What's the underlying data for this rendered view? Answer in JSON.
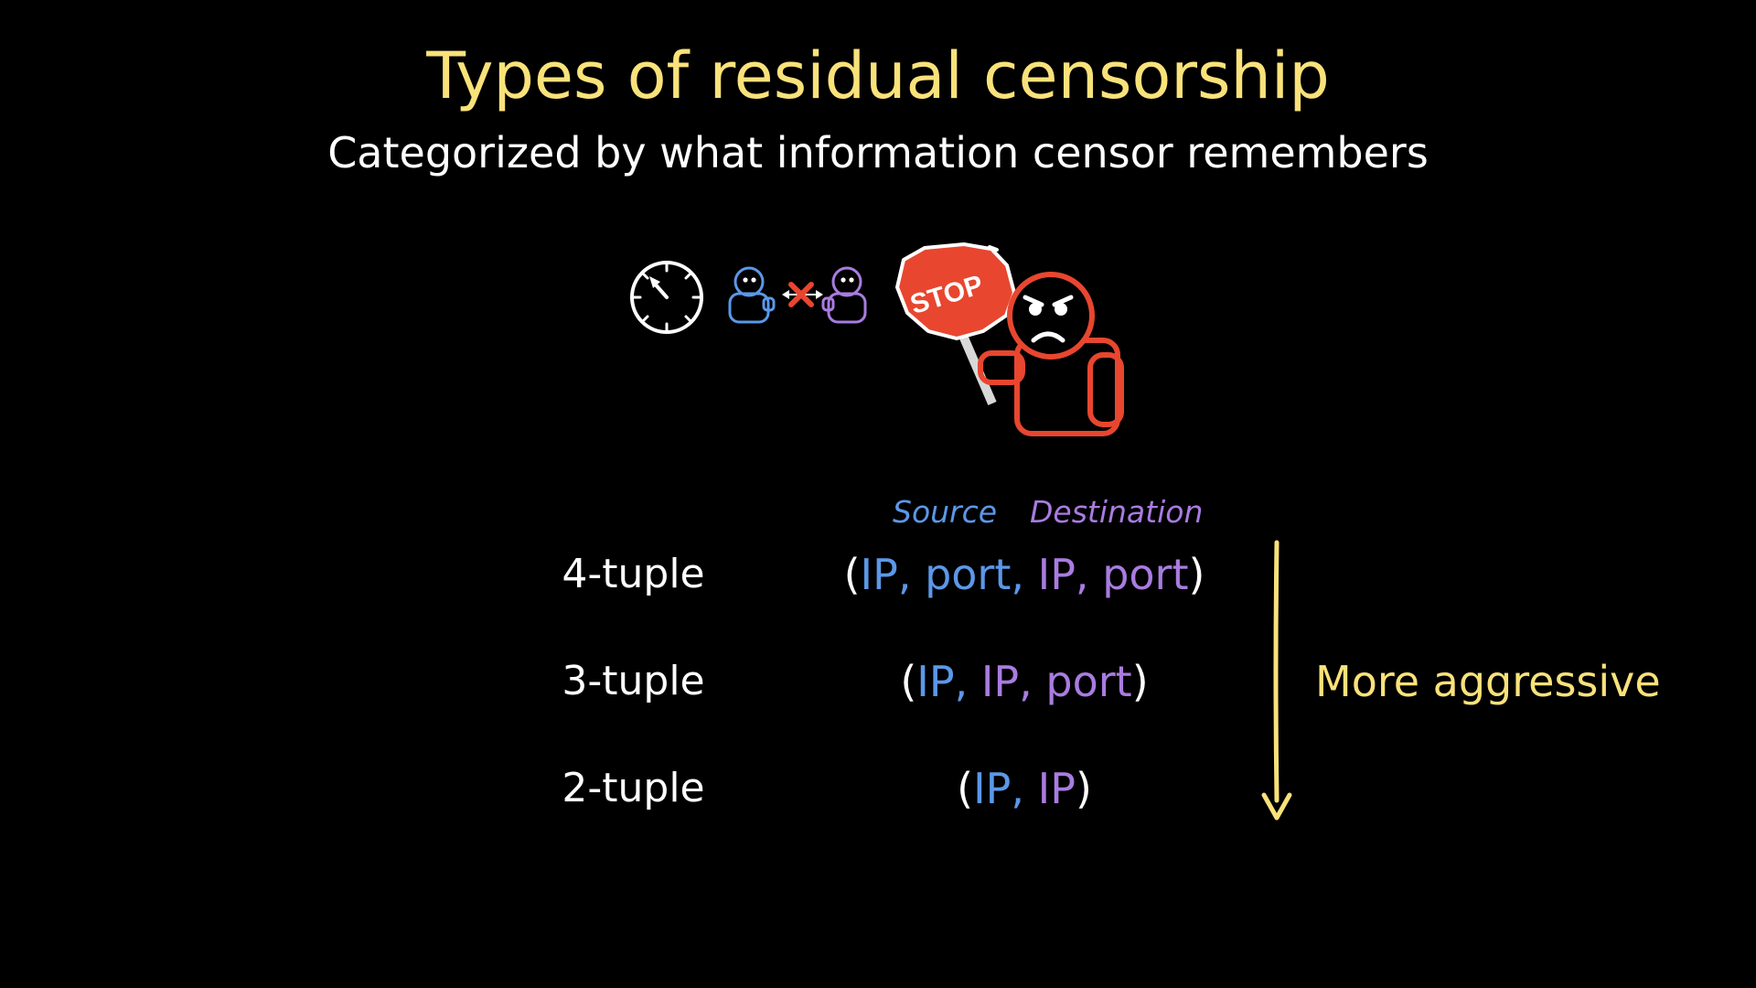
{
  "title": "Types of residual censorship",
  "subtitle": "Categorized by what information censor remembers",
  "illustration": {
    "stop_sign_text": "STOP",
    "colors": {
      "timer": "#ffffff",
      "client": "#5b98e8",
      "server": "#a97ce0",
      "block_mark": "#e8462f",
      "censor": "#e8462f",
      "sign_pole": "#d8d8d8"
    }
  },
  "columns": {
    "source": "Source",
    "destination": "Destination"
  },
  "rows": [
    {
      "label": "4-tuple",
      "open": "(",
      "parts": [
        {
          "text": "IP,",
          "role": "source"
        },
        {
          "text": "port,",
          "role": "source"
        },
        {
          "text": "IP,",
          "role": "destination"
        },
        {
          "text": "port",
          "role": "destination"
        }
      ],
      "close": ")"
    },
    {
      "label": "3-tuple",
      "open": "(",
      "parts": [
        {
          "text": "IP,",
          "role": "source"
        },
        {
          "text": "IP,",
          "role": "destination"
        },
        {
          "text": "port",
          "role": "destination"
        }
      ],
      "close": ")"
    },
    {
      "label": "2-tuple",
      "open": "(",
      "parts": [
        {
          "text": "IP,",
          "role": "source"
        },
        {
          "text": "IP",
          "role": "destination"
        }
      ],
      "close": ")"
    }
  ],
  "trend_label": "More aggressive",
  "colors": {
    "background": "#000000",
    "title": "#f9e27a",
    "text": "#ffffff",
    "source": "#5b98e8",
    "destination": "#a97ce0",
    "accent": "#f9e27a"
  }
}
